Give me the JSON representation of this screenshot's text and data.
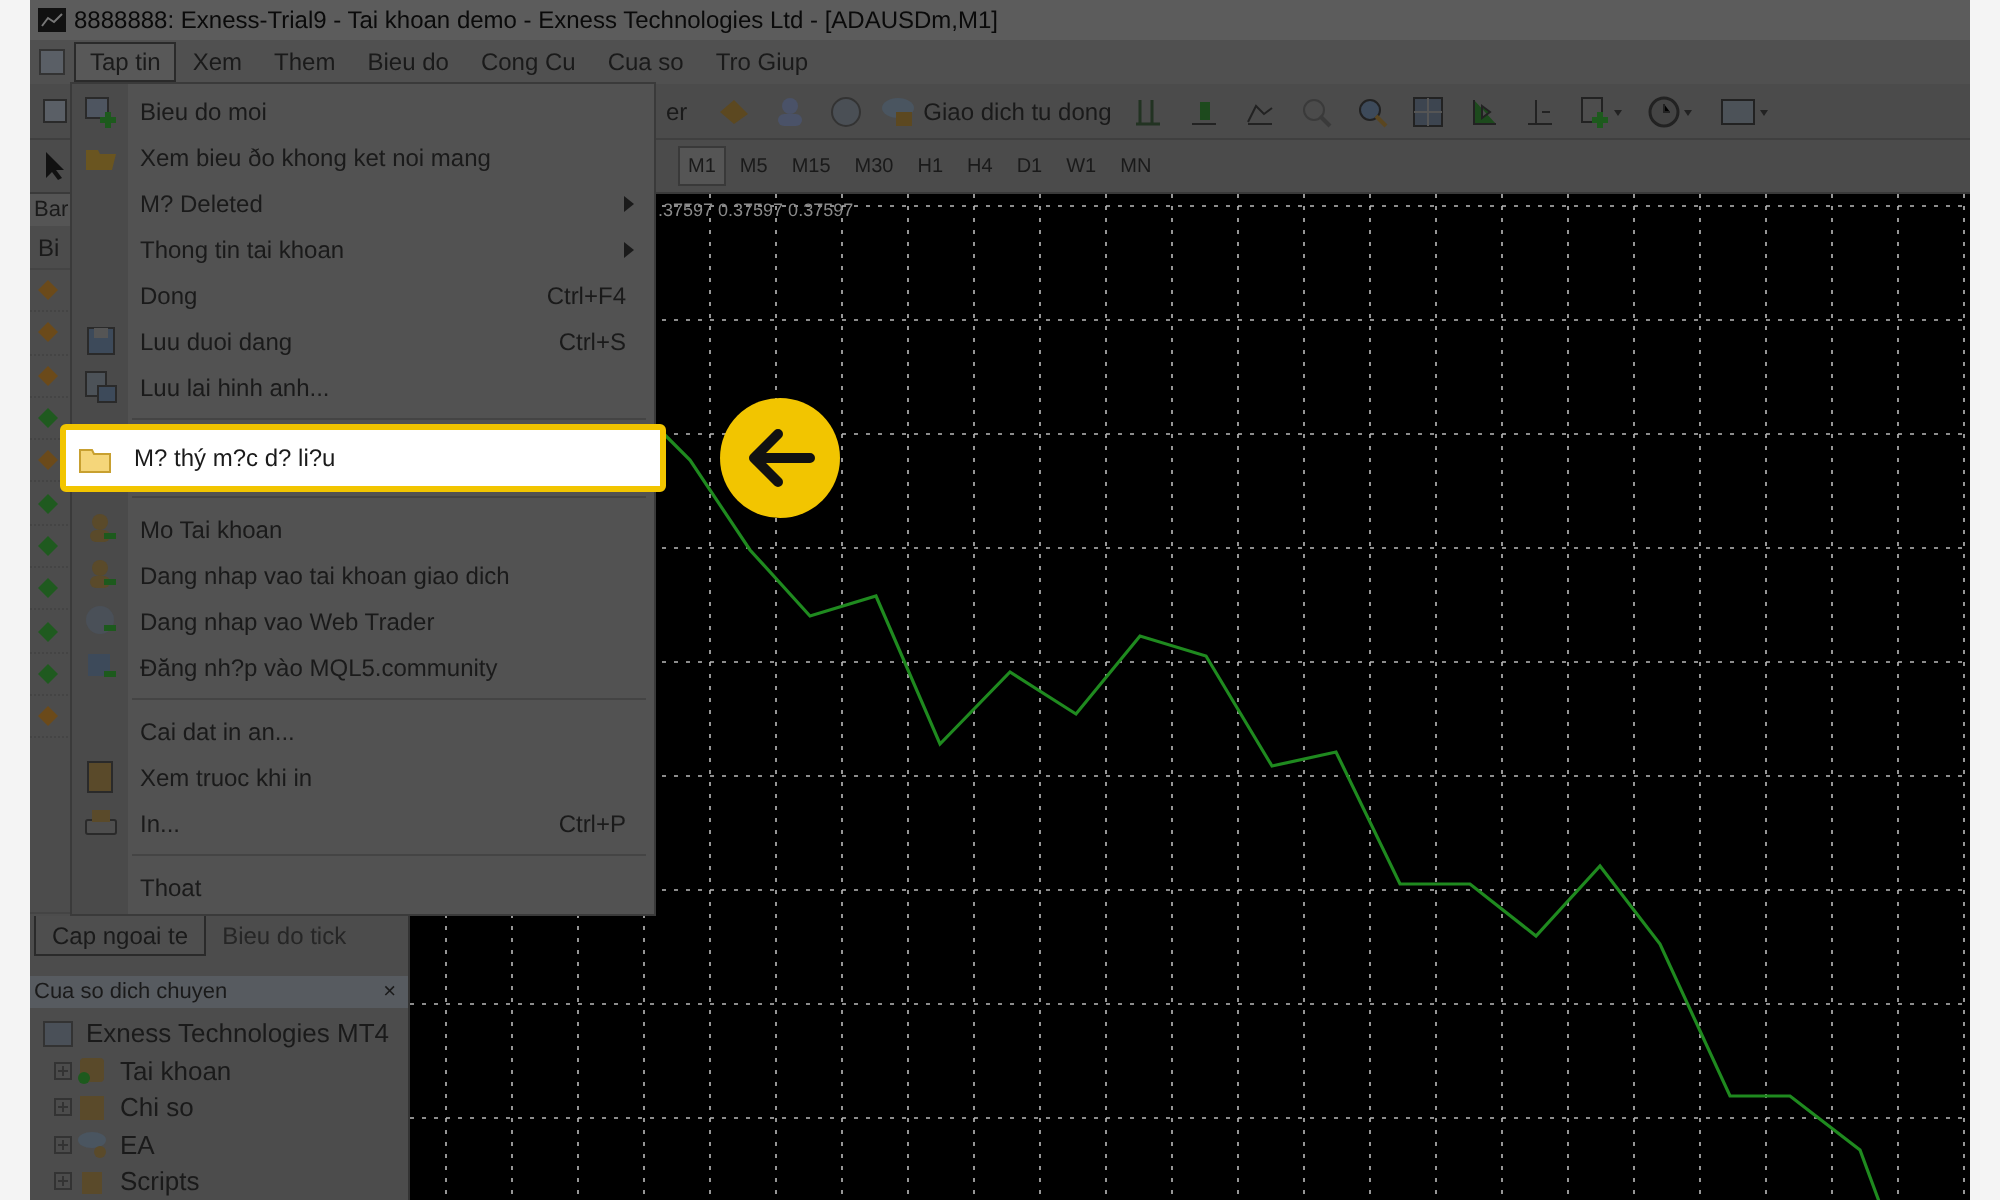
{
  "window": {
    "title": "8888888: Exness-Trial9 - Tai khoan demo - Exness Technologies Ltd - [ADAUSDm,M1]"
  },
  "menu_bar": [
    {
      "label": "Tap tin",
      "selected": true
    },
    {
      "label": "Xem",
      "selected": false
    },
    {
      "label": "Them",
      "selected": false
    },
    {
      "label": "Bieu do",
      "selected": false
    },
    {
      "label": "Cong Cu",
      "selected": false
    },
    {
      "label": "Cua so",
      "selected": false
    },
    {
      "label": "Tro Giup",
      "selected": false
    }
  ],
  "toolbar": {
    "partial_label": "er",
    "auto_trading_button": "Giao dich tu dong"
  },
  "timeframes": [
    {
      "label": "M1",
      "selected": true
    },
    {
      "label": "M5",
      "selected": false
    },
    {
      "label": "M15",
      "selected": false
    },
    {
      "label": "M30",
      "selected": false
    },
    {
      "label": "H1",
      "selected": false
    },
    {
      "label": "H4",
      "selected": false
    },
    {
      "label": "D1",
      "selected": false
    },
    {
      "label": "W1",
      "selected": false
    },
    {
      "label": "MN",
      "selected": false
    }
  ],
  "chart": {
    "price_readout": ".37597 0.37597 0.37597"
  },
  "market_watch": {
    "title": "Bar",
    "column_1": "Bi",
    "rows": [
      {
        "color": "#6b4a1a"
      },
      {
        "color": "#6b4a1a"
      },
      {
        "color": "#6b4a1a"
      },
      {
        "color": "#1f5a1f"
      },
      {
        "color": "#6b4a1a"
      },
      {
        "color": "#1f5a1f"
      },
      {
        "color": "#1f5a1f"
      },
      {
        "color": "#1f5a1f"
      },
      {
        "color": "#1f5a1f"
      },
      {
        "color": "#1f5a1f"
      },
      {
        "color": "#6b4a1a"
      }
    ]
  },
  "market_watch_tabs": [
    {
      "label": "Cap ngoai te",
      "selected": true
    },
    {
      "label": "Bieu do tick",
      "selected": false
    }
  ],
  "navigator": {
    "title": "Cua so dich chuyen",
    "close": "×",
    "tree": [
      {
        "label": "Exness Technologies MT4",
        "children": [
          {
            "label": "Tai khoan"
          },
          {
            "label": "Chi so"
          },
          {
            "label": "EA"
          },
          {
            "label": "Scripts"
          }
        ]
      }
    ]
  },
  "file_menu": {
    "items": [
      {
        "kind": "item",
        "label": "Bieu do moi",
        "selected": false
      },
      {
        "kind": "item",
        "label": "Xem bieu ðo khong ket noi mang",
        "selected": false
      },
      {
        "kind": "item",
        "label": "M? Deleted",
        "submenu": true,
        "selected": false
      },
      {
        "kind": "item",
        "label": "Thong tin tai khoan",
        "submenu": true,
        "selected": false
      },
      {
        "kind": "item",
        "label": "Dong",
        "shortcut": "Ctrl+F4",
        "selected": false
      },
      {
        "kind": "item",
        "label": "Luu duoi dang",
        "shortcut": "Ctrl+S",
        "selected": false
      },
      {
        "kind": "item",
        "label": "Luu lai hinh anh...",
        "selected": false
      },
      {
        "kind": "separator"
      },
      {
        "kind": "item",
        "label": "M? thý m?c d? li?u",
        "selected": true
      },
      {
        "kind": "separator"
      },
      {
        "kind": "item",
        "label": "Mo Tai khoan",
        "selected": false
      },
      {
        "kind": "item",
        "label": "Dang nhap vao tai khoan giao dich",
        "selected": false
      },
      {
        "kind": "item",
        "label": "Dang nhap vao Web Trader",
        "selected": false
      },
      {
        "kind": "item",
        "label": "Ðăng nh?p vào MQL5.community",
        "selected": false
      },
      {
        "kind": "separator"
      },
      {
        "kind": "item",
        "label": "Cai dat in an...",
        "selected": false
      },
      {
        "kind": "item",
        "label": "Xem truoc khi in",
        "selected": false
      },
      {
        "kind": "item",
        "label": "In...",
        "shortcut": "Ctrl+P",
        "selected": false
      },
      {
        "kind": "separator"
      },
      {
        "kind": "item",
        "label": "Thoat",
        "selected": false
      }
    ]
  }
}
